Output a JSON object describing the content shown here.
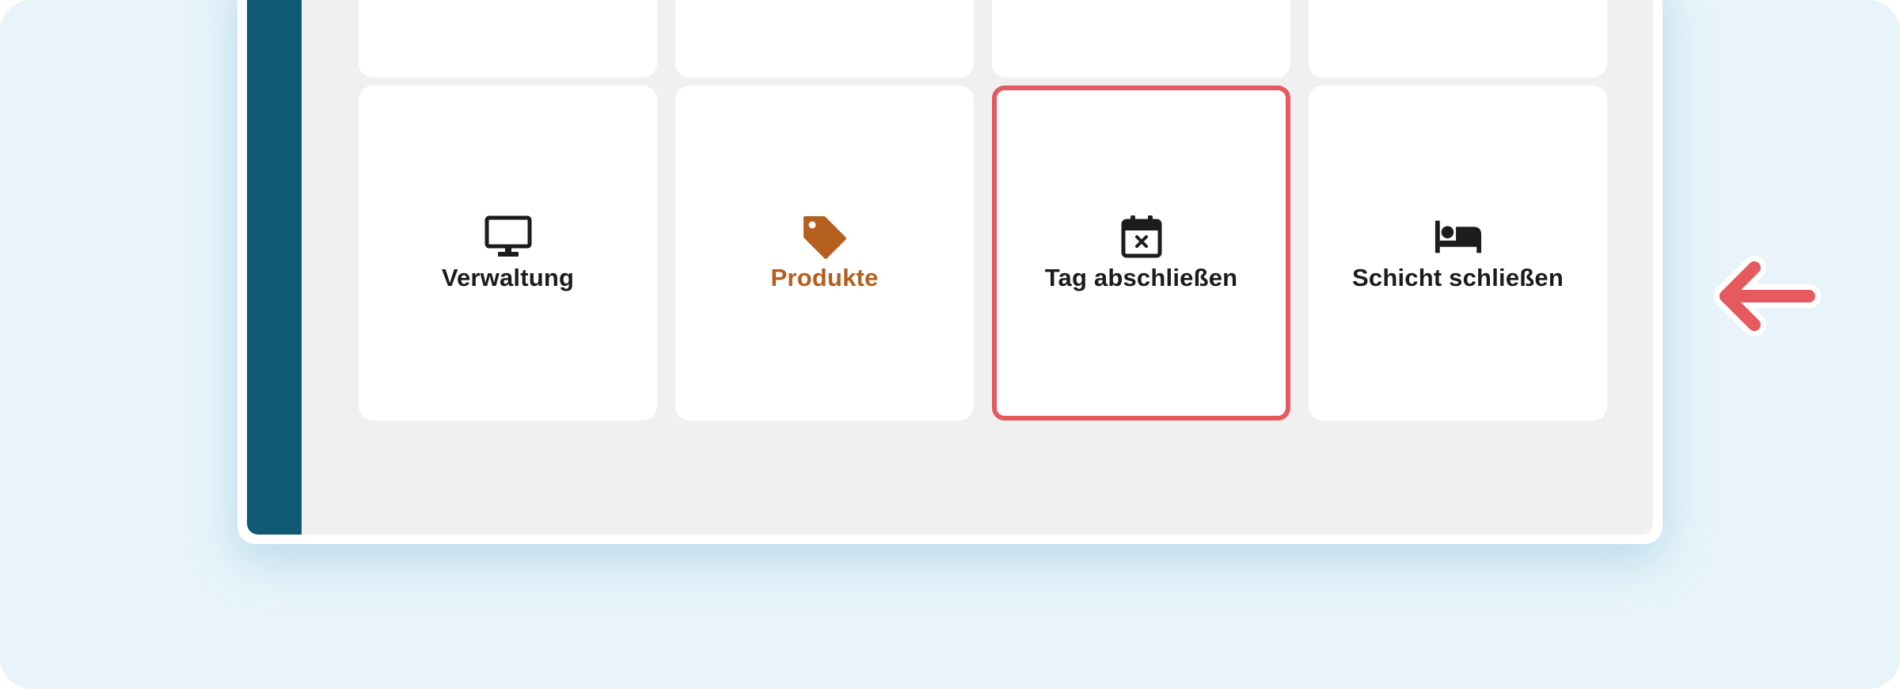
{
  "tiles_top_row": [
    {
      "name": "tile-top-1"
    },
    {
      "name": "tile-top-2"
    },
    {
      "name": "tile-top-3"
    },
    {
      "name": "tile-top-4"
    }
  ],
  "tiles": [
    {
      "label": "Verwaltung",
      "icon": "monitor-icon"
    },
    {
      "label": "Produkte",
      "icon": "price-tag-icon",
      "color": "#b5601f"
    },
    {
      "label": "Tag abschließen",
      "icon": "calendar-close-icon",
      "highlighted": true
    },
    {
      "label": "Schicht schließen",
      "icon": "bed-icon"
    }
  ],
  "colors": {
    "background": "#e8f4fa",
    "sidebar": "#0f5975",
    "panel": "#f0f0f0",
    "highlight": "#e45a5e",
    "accent": "#b5601f",
    "text": "#1c1c1c"
  },
  "pointer_icon": "arrow-left-icon"
}
